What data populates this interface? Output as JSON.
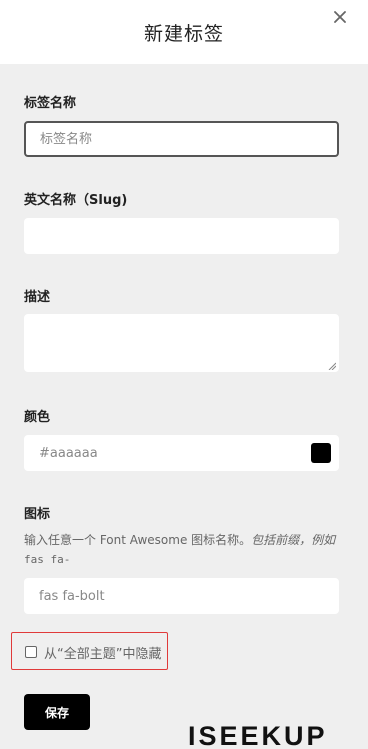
{
  "dialog": {
    "title": "新建标签"
  },
  "fields": {
    "name": {
      "label": "标签名称",
      "placeholder": "标签名称"
    },
    "slug": {
      "label": "英文名称（Slug)",
      "value": ""
    },
    "description": {
      "label": "描述",
      "value": ""
    },
    "color": {
      "label": "颜色",
      "placeholder": "#aaaaaa",
      "swatch": "#000000"
    },
    "icon": {
      "label": "图标",
      "help_prefix": "输入任意一个 Font Awesome 图标名称。",
      "help_italic": "包括前缀，例如",
      "help_code": "fas fa-",
      "placeholder": "fas fa-bolt"
    }
  },
  "hide_option": {
    "label": "从“全部主题”中隐藏",
    "checked": false
  },
  "save_label": "保存",
  "watermark": "ISEEKUP",
  "colors": {
    "body_bg": "#efefef",
    "highlight_border": "#e03a3a",
    "primary_button": "#000000"
  }
}
